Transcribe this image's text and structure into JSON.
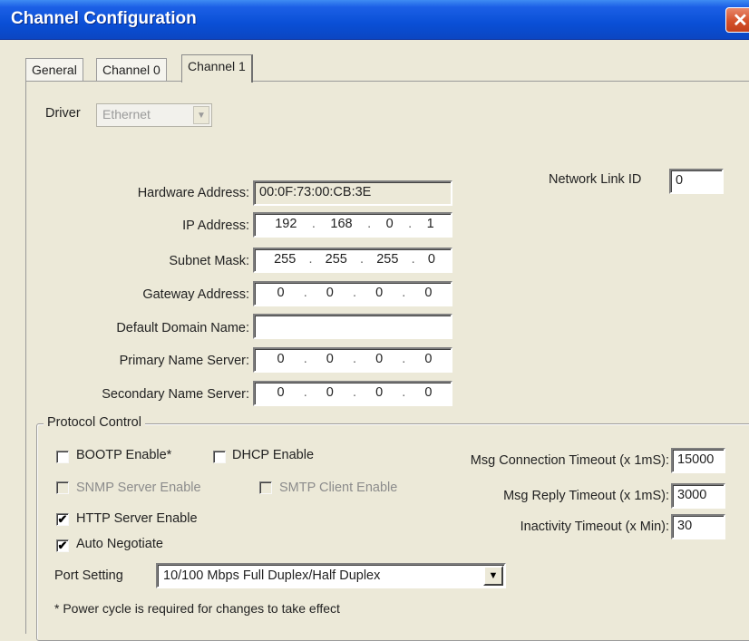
{
  "window": {
    "title": "Channel Configuration",
    "close_glyph": "✕"
  },
  "tabs": [
    {
      "label": "General"
    },
    {
      "label": "Channel 0"
    },
    {
      "label": "Channel 1"
    }
  ],
  "driver": {
    "label": "Driver",
    "value": "Ethernet",
    "arrow": "▼"
  },
  "network_link_id": {
    "label": "Network Link ID",
    "value": "0"
  },
  "fields": {
    "hardware_address": {
      "label": "Hardware Address:",
      "value": "00:0F:73:00:CB:3E"
    },
    "ip_address": {
      "label": "IP Address:",
      "octets": [
        "192",
        "168",
        "0",
        "1"
      ]
    },
    "subnet_mask": {
      "label": "Subnet Mask:",
      "octets": [
        "255",
        "255",
        "255",
        "0"
      ]
    },
    "gateway_address": {
      "label": "Gateway Address:",
      "octets": [
        "0",
        "0",
        "0",
        "0"
      ]
    },
    "default_domain_name": {
      "label": "Default Domain Name:",
      "value": ""
    },
    "primary_name_server": {
      "label": "Primary Name Server:",
      "octets": [
        "0",
        "0",
        "0",
        "0"
      ]
    },
    "secondary_name_server": {
      "label": "Secondary Name Server:",
      "octets": [
        "0",
        "0",
        "0",
        "0"
      ]
    }
  },
  "octet_separator": ".",
  "protocol_control": {
    "title": "Protocol Control",
    "checkboxes": {
      "bootp": {
        "label": "BOOTP Enable*",
        "checked": false,
        "enabled": true
      },
      "dhcp": {
        "label": "DHCP Enable",
        "checked": false,
        "enabled": true
      },
      "snmp": {
        "label": "SNMP Server Enable",
        "checked": false,
        "enabled": false
      },
      "smtp": {
        "label": "SMTP Client Enable",
        "checked": false,
        "enabled": false
      },
      "http": {
        "label": "HTTP Server Enable",
        "checked": true,
        "enabled": true
      },
      "auto_negotiate": {
        "label": "Auto Negotiate",
        "checked": true,
        "enabled": true
      }
    },
    "check_glyph": "✔",
    "msg_connection_timeout": {
      "label": "Msg Connection Timeout (x 1mS):",
      "value": "15000"
    },
    "msg_reply_timeout": {
      "label": "Msg Reply Timeout (x 1mS):",
      "value": "3000"
    },
    "inactivity_timeout": {
      "label": "Inactivity Timeout (x Min):",
      "value": "30"
    },
    "port_setting": {
      "label": "Port Setting",
      "value": "10/100 Mbps Full Duplex/Half Duplex",
      "arrow": "▼"
    },
    "footnote": "* Power cycle is required for changes to take effect"
  }
}
